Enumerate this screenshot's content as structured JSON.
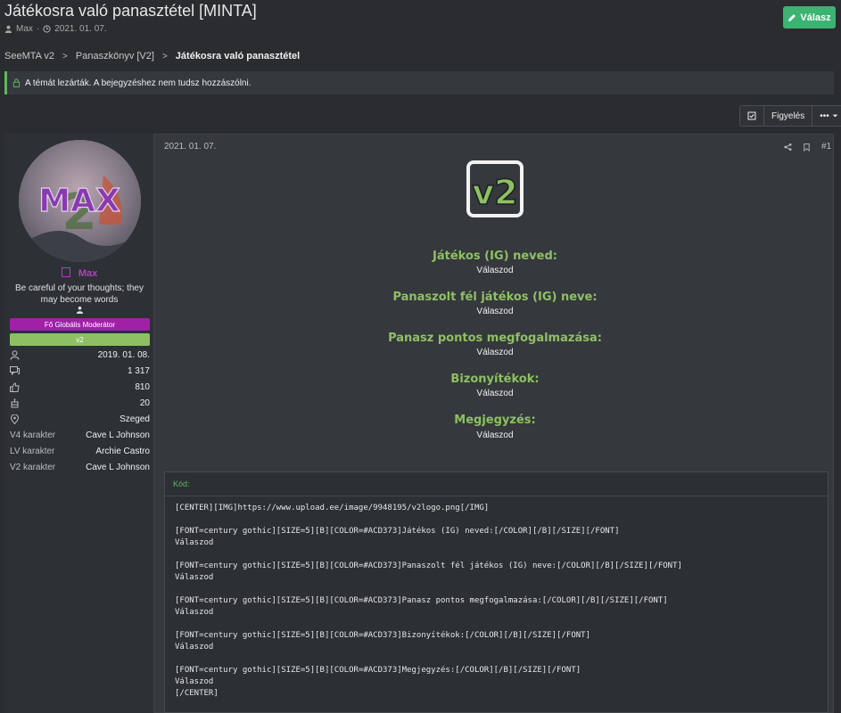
{
  "thread": {
    "title": "Játékosra való panasztétel [MINTA]",
    "author": "Max",
    "meta_sep": "·",
    "date": "2021. 01. 07."
  },
  "reply_button": {
    "label": "Válasz"
  },
  "breadcrumb": {
    "items": [
      "SeeMTA v2",
      "Panaszkönyv [V2]",
      "Játékosra való panasztétel"
    ],
    "separator": ">"
  },
  "notice": {
    "text": "A témát lezárták. A bejegyzéshez nem tudsz hozzászólni."
  },
  "thread_actions": {
    "watch_label": "Figyelés",
    "more_label": "•••"
  },
  "user": {
    "avatar_text": "MAX",
    "name": "Max",
    "title": "Be careful of your thoughts; they may become words",
    "badges": [
      {
        "label": "Fő Globális Moderátor",
        "color": "#a020a8"
      },
      {
        "label": "v2",
        "color": "#8ec063"
      }
    ],
    "stats": [
      {
        "icon": "user-icon",
        "value": "2019. 01. 08."
      },
      {
        "icon": "messages-icon",
        "value": "1 317"
      },
      {
        "icon": "thumbs-up-icon",
        "value": "810"
      },
      {
        "icon": "trophy-icon",
        "value": "20"
      },
      {
        "icon": "location-pin-icon",
        "value": "Szeged"
      }
    ],
    "fields": [
      {
        "label": "V4 karakter",
        "value": "Cave L Johnson"
      },
      {
        "label": "LV karakter",
        "value": "Archie Castro"
      },
      {
        "label": "V2 karakter",
        "value": "Cave L Johnson"
      }
    ]
  },
  "post": {
    "date": "2021. 01. 07.",
    "number": "#1",
    "logo_text": "v2",
    "sections": [
      {
        "heading": "Játékos (IG) neved:",
        "answer": "Válaszod"
      },
      {
        "heading": "Panaszolt fél játékos (IG) neve:",
        "answer": "Válaszod"
      },
      {
        "heading": "Panasz pontos megfogalmazása:",
        "answer": "Válaszod"
      },
      {
        "heading": "Bizonyítékok:",
        "answer": "Válaszod"
      },
      {
        "heading": "Megjegyzés:",
        "answer": "Válaszod"
      }
    ],
    "code": {
      "label": "Kód:",
      "text": "[CENTER][IMG]https://www.upload.ee/image/9948195/v2logo.png[/IMG]\n\n[FONT=century gothic][SIZE=5][B][COLOR=#ACD373]Játékos (IG) neved:[/COLOR][/B][/SIZE][/FONT]\nVálaszod\n\n[FONT=century gothic][SIZE=5][B][COLOR=#ACD373]Panaszolt fél játékos (IG) neve:[/COLOR][/B][/SIZE][/FONT]\nVálaszod\n\n[FONT=century gothic][SIZE=5][B][COLOR=#ACD373]Panasz pontos megfogalmazása:[/COLOR][/B][/SIZE][/FONT]\nVálaszod\n\n[FONT=century gothic][SIZE=5][B][COLOR=#ACD373]Bizonyítékok:[/COLOR][/B][/SIZE][/FONT]\nVálaszod\n\n[FONT=century gothic][SIZE=5][B][COLOR=#ACD373]Megjegyzés:[/COLOR][/B][/SIZE][/FONT]\nVálaszod\n[/CENTER]"
    }
  },
  "colors": {
    "accent_green": "#3cb371",
    "heading_green": "#8ec063",
    "moderator_purple": "#a020a8"
  }
}
